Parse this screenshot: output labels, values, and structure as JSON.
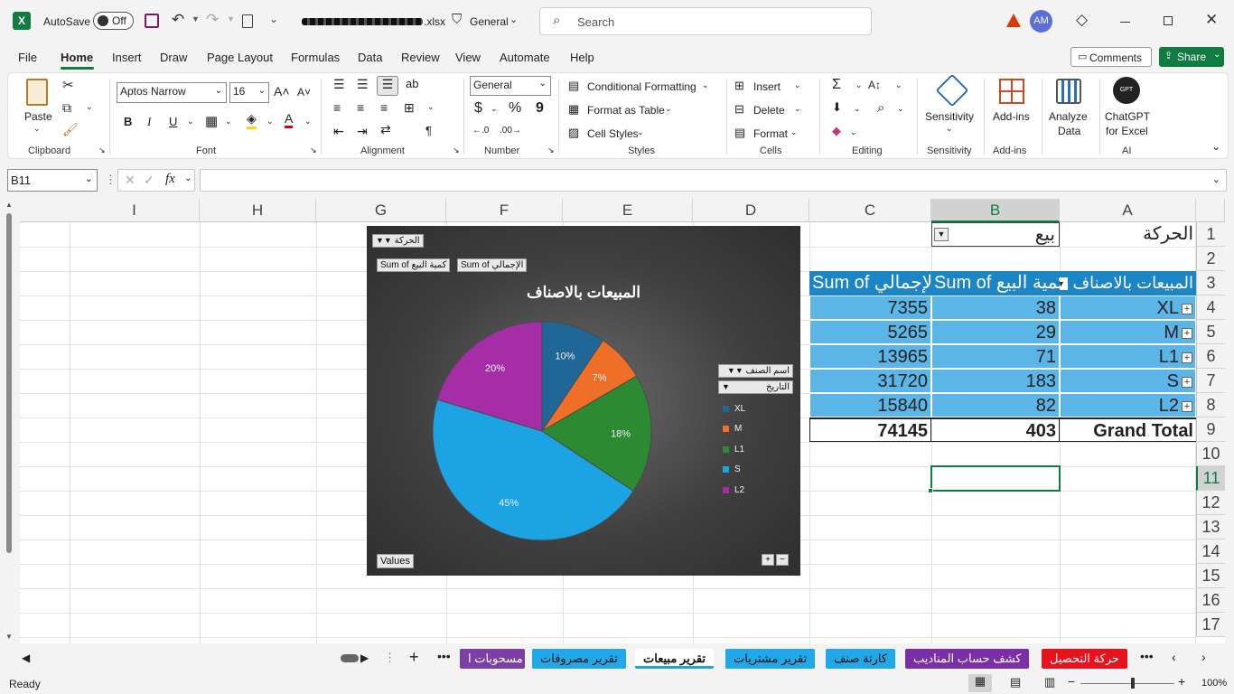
{
  "titlebar": {
    "autosave_label": "AutoSave",
    "autosave_state": "Off",
    "filename_ext": ".xlsx",
    "sensitivity": "General",
    "search_placeholder": "Search",
    "user_initials": "AM"
  },
  "menu": [
    "File",
    "Home",
    "Insert",
    "Draw",
    "Page Layout",
    "Formulas",
    "Data",
    "Review",
    "View",
    "Automate",
    "Help"
  ],
  "menu_right": {
    "comments": "Comments",
    "share": "Share"
  },
  "ribbon": {
    "clipboard": {
      "paste": "Paste",
      "label": "Clipboard"
    },
    "font": {
      "name": "Aptos Narrow",
      "size": "16",
      "bold": "B",
      "italic": "I",
      "underline": "U",
      "label": "Font"
    },
    "alignment": {
      "label": "Alignment"
    },
    "number": {
      "format": "General",
      "currency": "$",
      "percent": "%",
      "comma": "9",
      "label": "Number"
    },
    "styles": {
      "conditional": "Conditional Formatting",
      "table": "Format as Table",
      "cell_styles": "Cell Styles",
      "label": "Styles"
    },
    "cells": {
      "insert": "Insert",
      "delete": "Delete",
      "format": "Format",
      "label": "Cells"
    },
    "editing": {
      "label": "Editing"
    },
    "sensitivity": {
      "btn": "Sensitivity",
      "label": "Sensitivity"
    },
    "addins": {
      "btn": "Add-ins",
      "label": "Add-ins"
    },
    "analyze": {
      "line1": "Analyze",
      "line2": "Data"
    },
    "chatgpt": {
      "line1": "ChatGPT",
      "line2": "for Excel",
      "logo": "GPT",
      "label": "AI"
    }
  },
  "formula_bar": {
    "name_box": "B11",
    "fx": "fx",
    "value": ""
  },
  "columns": [
    "I",
    "H",
    "G",
    "F",
    "E",
    "D",
    "C",
    "B",
    "A"
  ],
  "rows": [
    "1",
    "2",
    "3",
    "4",
    "5",
    "6",
    "7",
    "8",
    "9",
    "10",
    "11",
    "12",
    "13",
    "14",
    "15",
    "16",
    "17"
  ],
  "pivot": {
    "filter_label": "الحركة",
    "filter_value": "بيع",
    "row_header": "المبيعات بالاصناف",
    "col_qty": "Sum of كمية البيع",
    "col_total": "Sum of الإجمالي",
    "rows": [
      {
        "label": "XL",
        "qty": "38",
        "total": "7355"
      },
      {
        "label": "M",
        "qty": "29",
        "total": "5265"
      },
      {
        "label": "L1",
        "qty": "71",
        "total": "13965"
      },
      {
        "label": "S",
        "qty": "183",
        "total": "31720"
      },
      {
        "label": "L2",
        "qty": "82",
        "total": "15840"
      }
    ],
    "grand_label": "Grand Total",
    "grand_qty": "403",
    "grand_total": "74145"
  },
  "chart_ui": {
    "filter_btn": "الحركة",
    "values_btn1": "Sum of كمية البيع",
    "values_btn2": "Sum of الإجمالي",
    "axis_btn1": "اسم الصنف",
    "axis_btn2": "التاريخ",
    "values_btn": "Values"
  },
  "chart_data": {
    "type": "pie",
    "title": "المبيعات بالاصناف",
    "categories": [
      "XL",
      "M",
      "L1",
      "S",
      "L2"
    ],
    "values": [
      38,
      29,
      71,
      183,
      82
    ],
    "data_labels": [
      "10%",
      "7%",
      "18%",
      "45%",
      "20%"
    ],
    "colors": [
      "#1f6796",
      "#ef6e28",
      "#2c8a33",
      "#1ba3e4",
      "#a52da7"
    ],
    "legend": "right"
  },
  "sheet_tabs": [
    {
      "label": "مسحوبات ا",
      "bg": "#7b3fa6",
      "fg": "#ffffff"
    },
    {
      "label": "تقرير مصروفات",
      "bg": "#20a8e8",
      "fg": "#111111"
    },
    {
      "label": "تقرير مبيعات",
      "bg": "#ffffff",
      "fg": "#111111",
      "active": true
    },
    {
      "label": "تقرير مشتريات",
      "bg": "#20a8e8",
      "fg": "#111111"
    },
    {
      "label": "كارتة صنف",
      "bg": "#20a8e8",
      "fg": "#111111"
    },
    {
      "label": "كشف حساب المناديب",
      "bg": "#7b2fa6",
      "fg": "#ffffff"
    },
    {
      "label": "حركة التحصيل",
      "bg": "#e8121c",
      "fg": "#ffffff"
    }
  ],
  "status": {
    "ready": "Ready",
    "zoom": "100%"
  }
}
